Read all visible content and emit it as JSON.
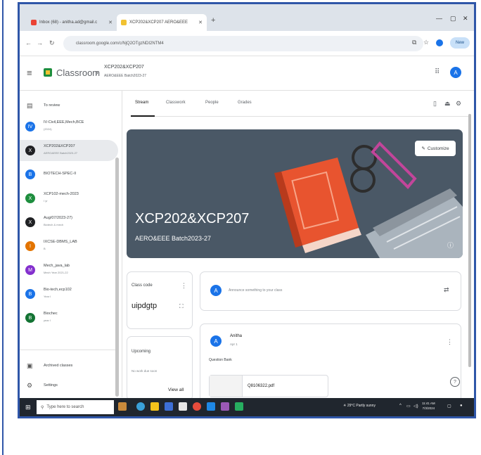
{
  "browser": {
    "tabs": [
      {
        "label": "Inbox (68) - anitha.ad@gmail.c"
      },
      {
        "label": "XCP202&XCP207 AERO&EEE"
      }
    ],
    "url": "classroom.google.com/c/NjQ2OTgzNDI2NTM4",
    "new_chrome_label": "New"
  },
  "header": {
    "brand": "Classroom",
    "class_title": "XCP202&XCP207",
    "class_subtitle": "AERO&EEE Batch2023-27",
    "avatar_letter": "A"
  },
  "sidebar": {
    "to_review": "To review",
    "classes": [
      {
        "letter": "IV",
        "title": "IV-Civil,EEE,Mech,BCE",
        "sub": "(2024)",
        "color": "#1a73e8"
      },
      {
        "letter": "X",
        "title": "XCP202&XCP207",
        "sub": "AERO&EEE Batch2023-27",
        "color": "#202124"
      },
      {
        "letter": "B",
        "title": "BIOTECH-SPEC-II",
        "sub": "",
        "color": "#1a73e8"
      },
      {
        "letter": "X",
        "title": "XCP102-mech-2023",
        "sub": "I yr",
        "color": "#1e8e3e"
      },
      {
        "letter": "X",
        "title": "Aug/07/2023-27)",
        "sub": "Biotech & mech",
        "color": "#202124"
      },
      {
        "letter": "I",
        "title": "IXCSE-DBMS_LAB",
        "sub": "B",
        "color": "#e37400"
      },
      {
        "letter": "M",
        "title": "Mech_java_lab",
        "sub": "Mech Year 2021-22",
        "color": "#8430ce"
      },
      {
        "letter": "B",
        "title": "Bio-tech,ecp102",
        "sub": "Year I",
        "color": "#1a73e8"
      },
      {
        "letter": "B",
        "title": "Biochec",
        "sub": "year I",
        "color": "#137333"
      }
    ],
    "archived": "Archived classes",
    "settings": "Settings"
  },
  "main": {
    "tabs": [
      "Stream",
      "Classwork",
      "People",
      "Grades"
    ],
    "banner": {
      "title": "XCP202&XCP207",
      "subtitle": "AERO&EEE Batch2023-27",
      "customize": "Customize"
    },
    "class_code": {
      "label": "Class code",
      "value": "uipdgtp"
    },
    "announce": {
      "avatar": "A",
      "placeholder": "Announce something to your class"
    },
    "upcoming": {
      "label": "Upcoming",
      "note": "No work due soon",
      "view_all": "View all"
    },
    "post": {
      "avatar": "A",
      "author": "Anitha",
      "date": "Apr 1",
      "text": "Question Bank",
      "attachment": "Q8106322.pdf"
    }
  },
  "taskbar": {
    "search_placeholder": "Type here to search",
    "weather": "29°C  Partly sunny",
    "time": "11:41 AM",
    "date": "7/3/2024"
  }
}
